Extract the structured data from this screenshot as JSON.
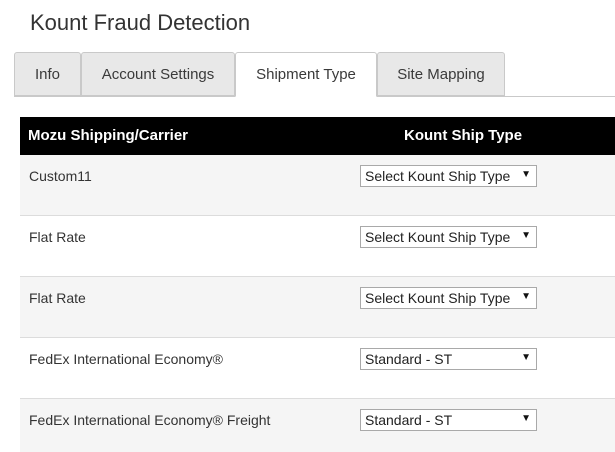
{
  "page": {
    "title": "Kount Fraud Detection"
  },
  "tabs": [
    {
      "label": "Info",
      "active": false
    },
    {
      "label": "Account Settings",
      "active": false
    },
    {
      "label": "Shipment Type",
      "active": true
    },
    {
      "label": "Site Mapping",
      "active": false
    }
  ],
  "table": {
    "headers": {
      "carrier": "Mozu Shipping/Carrier",
      "kount": "Kount Ship Type"
    },
    "rows": [
      {
        "carrier": "Custom11",
        "select": "Select Kount Ship Type"
      },
      {
        "carrier": "Flat Rate",
        "select": "Select Kount Ship Type"
      },
      {
        "carrier": "Flat Rate",
        "select": "Select Kount Ship Type"
      },
      {
        "carrier": "FedEx International Economy®",
        "select": "Standard - ST"
      },
      {
        "carrier": "FedEx International Economy® Freight",
        "select": "Standard - ST"
      }
    ]
  },
  "icons": {
    "dropdown": "triangle-down-icon"
  },
  "colors": {
    "header_bg": "#000000",
    "header_text": "#ffffff",
    "tab_inactive_bg": "#e8e8e8",
    "row_alt_bg": "#f5f5f5"
  }
}
